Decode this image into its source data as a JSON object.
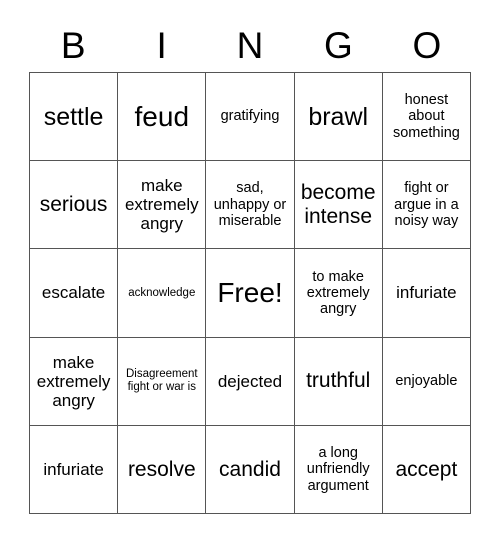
{
  "card": {
    "header_letters": [
      "B",
      "I",
      "N",
      "G",
      "O"
    ],
    "grid_size": 5,
    "free_space_label": "Free!",
    "colors": {
      "background": "#ffffff",
      "text": "#000000",
      "grid_line": "#555555"
    },
    "rows": [
      [
        {
          "text": "settle",
          "size": "lg"
        },
        {
          "text": "feud",
          "size": "xl"
        },
        {
          "text": "gratifying",
          "size": "xs"
        },
        {
          "text": "brawl",
          "size": "lg"
        },
        {
          "text": "honest about something",
          "size": "xs"
        }
      ],
      [
        {
          "text": "serious",
          "size": "md"
        },
        {
          "text": "make extremely angry",
          "size": "sm"
        },
        {
          "text": "sad, unhappy or miserable",
          "size": "xs"
        },
        {
          "text": "become intense",
          "size": "md"
        },
        {
          "text": "fight or argue in a noisy way",
          "size": "xs"
        }
      ],
      [
        {
          "text": "escalate",
          "size": "sm"
        },
        {
          "text": "acknowledge",
          "size": "xxs"
        },
        {
          "text": "Free!",
          "size": "xl"
        },
        {
          "text": "to make extremely angry",
          "size": "xs"
        },
        {
          "text": "infuriate",
          "size": "sm"
        }
      ],
      [
        {
          "text": "make extremely angry",
          "size": "sm"
        },
        {
          "text": "Disagreement fight or war is",
          "size": "xxs"
        },
        {
          "text": "dejected",
          "size": "sm"
        },
        {
          "text": "truthful",
          "size": "md"
        },
        {
          "text": "enjoyable",
          "size": "xs"
        }
      ],
      [
        {
          "text": "infuriate",
          "size": "sm"
        },
        {
          "text": "resolve",
          "size": "md"
        },
        {
          "text": "candid",
          "size": "md"
        },
        {
          "text": "a long unfriendly argument",
          "size": "xs"
        },
        {
          "text": "accept",
          "size": "md"
        }
      ]
    ]
  }
}
